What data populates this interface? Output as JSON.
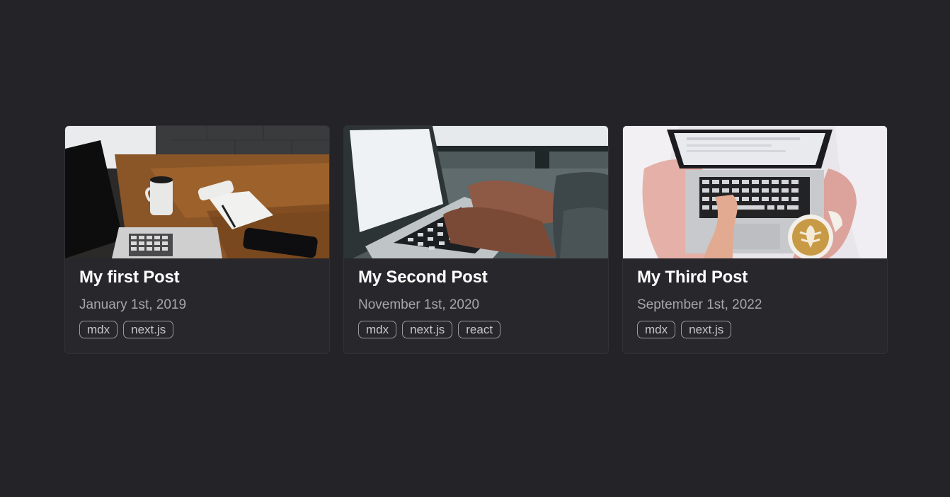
{
  "posts": [
    {
      "title": "My first Post",
      "date": "January 1st, 2019",
      "tags": [
        "mdx",
        "next.js"
      ],
      "image": "laptop on wooden desk with coffee mug, notepad and phone"
    },
    {
      "title": "My Second Post",
      "date": "November 1st, 2020",
      "tags": [
        "mdx",
        "next.js",
        "react"
      ],
      "image": "hands typing on laptop keyboard"
    },
    {
      "title": "My Third Post",
      "date": "September 1st, 2022",
      "tags": [
        "mdx",
        "next.js"
      ],
      "image": "laptop on lap with latte art coffee cup"
    }
  ],
  "colors": {
    "page_background": "#242328",
    "card_background": "#28272c",
    "title": "#ffffff",
    "date": "#a7a6ad",
    "tag_border": "#9b9aa1"
  }
}
